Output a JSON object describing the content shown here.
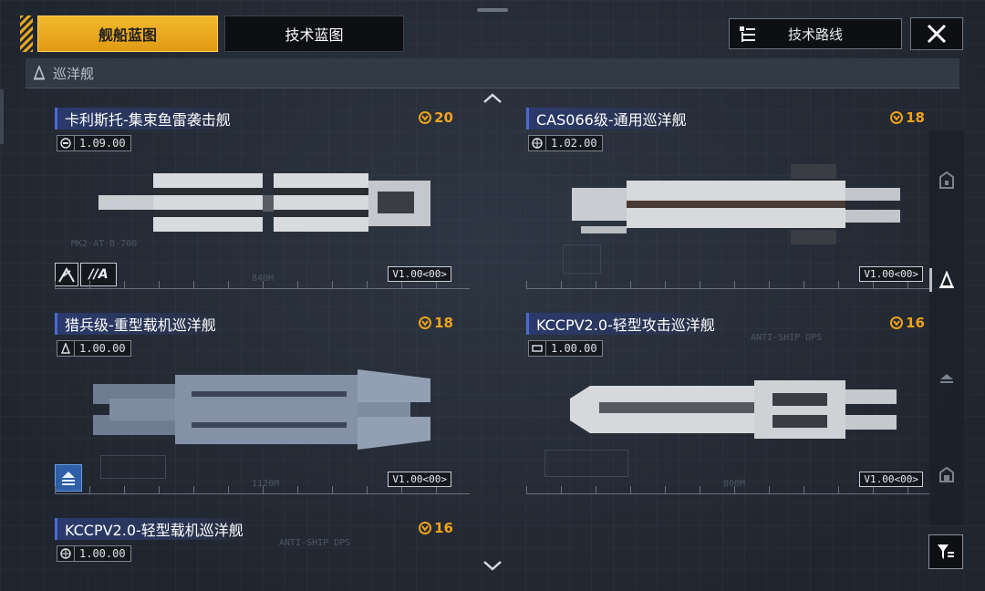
{
  "tabs": [
    {
      "label": "舰船蓝图",
      "active": true
    },
    {
      "label": "技术蓝图",
      "active": false
    }
  ],
  "top_right": {
    "route_label": "技术路线"
  },
  "category": {
    "label": "巡洋舰"
  },
  "ships": [
    {
      "name": "卡利斯托-集束鱼雷袭击舰",
      "cost": "20",
      "version": "1.09.00",
      "model": "V1.00<00>",
      "tag": "//A",
      "dim": "840M",
      "sub": "MK2-AT-B-700"
    },
    {
      "name": "CAS066级-通用巡洋舰",
      "cost": "18",
      "version": "1.02.00",
      "model": "V1.00<00>"
    },
    {
      "name": "猎兵级-重型载机巡洋舰",
      "cost": "18",
      "version": "1.00.00",
      "model": "V1.00<00>",
      "dim": "1120M"
    },
    {
      "name": "KCCPV2.0-轻型攻击巡洋舰",
      "cost": "16",
      "version": "1.00.00",
      "model": "V1.00<00>",
      "dim": "800M",
      "sub": "ANTI-SHIP DPS"
    },
    {
      "name": "KCCPV2.0-轻型载机巡洋舰",
      "cost": "16",
      "version": "1.00.00",
      "sub": "ANTI-SHIP DPS"
    }
  ],
  "colors": {
    "accent": "#f0a21a",
    "title_bg": "#2b3a6c",
    "panel": "#222833"
  }
}
